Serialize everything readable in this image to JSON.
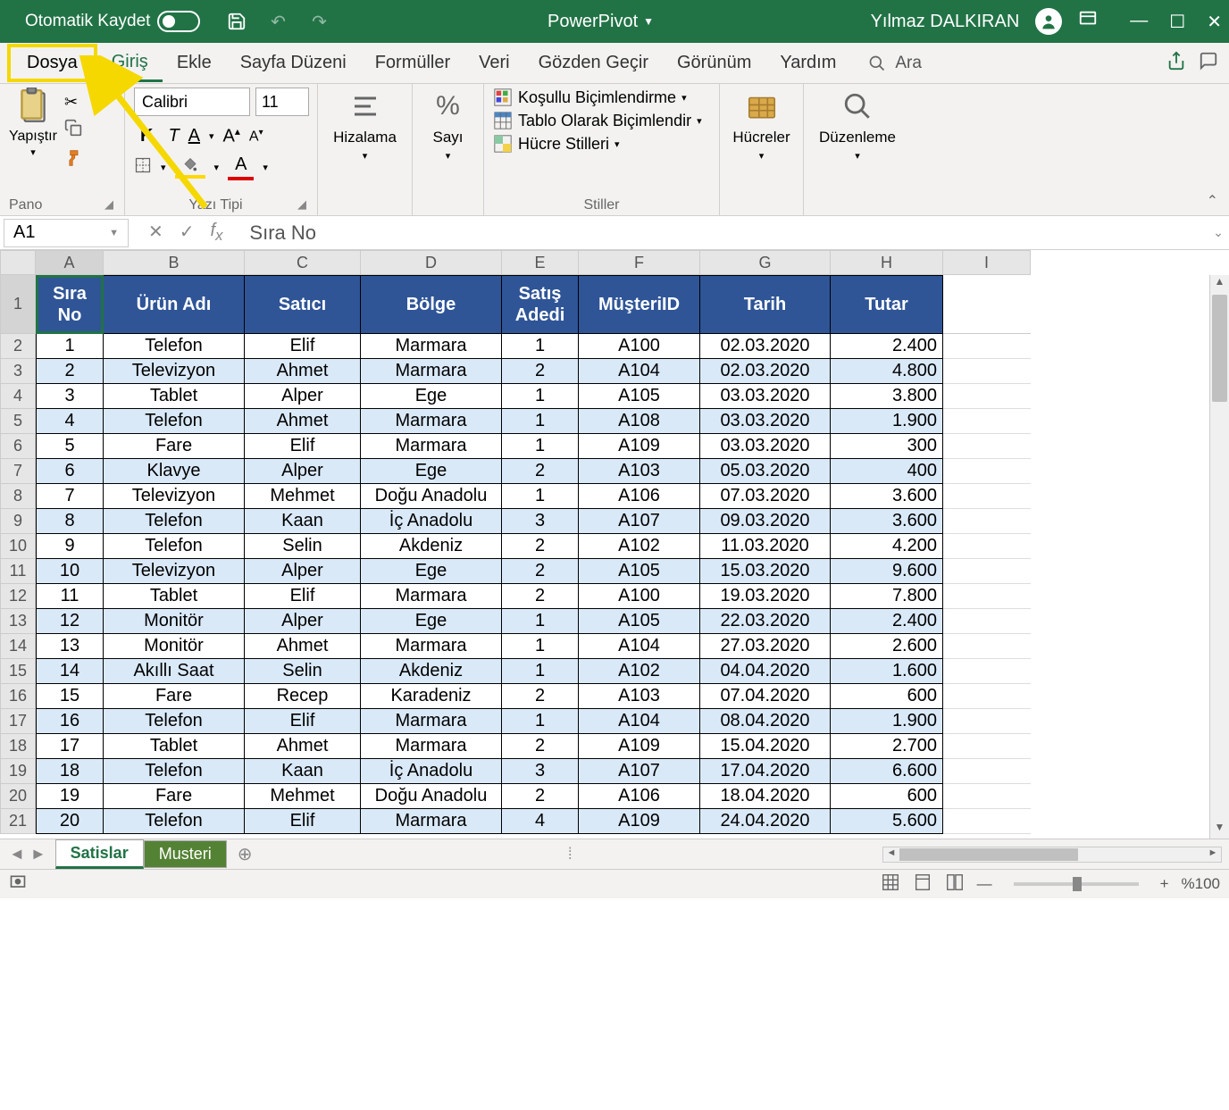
{
  "titlebar": {
    "autosave": "Otomatik Kaydet",
    "workbook": "PowerPivot",
    "user": "Yılmaz DALKIRAN"
  },
  "tabs": {
    "file": "Dosya",
    "home": "Giriş",
    "insert": "Ekle",
    "layout": "Sayfa Düzeni",
    "formulas": "Formüller",
    "data": "Veri",
    "review": "Gözden Geçir",
    "view": "Görünüm",
    "help": "Yardım",
    "search": "Ara"
  },
  "ribbon": {
    "paste": "Yapıştır",
    "clipboard": "Pano",
    "font_name": "Calibri",
    "font_size": "11",
    "font_group": "Yazı Tipi",
    "alignment": "Hizalama",
    "number": "Sayı",
    "cond_format": "Koşullu Biçimlendirme",
    "format_table": "Tablo Olarak Biçimlendir",
    "cell_styles": "Hücre Stilleri",
    "styles": "Stiller",
    "cells": "Hücreler",
    "editing": "Düzenleme"
  },
  "formula": {
    "cell": "A1",
    "value": "Sıra No"
  },
  "columns": [
    "A",
    "B",
    "C",
    "D",
    "E",
    "F",
    "G",
    "H",
    "I"
  ],
  "headers": [
    "Sıra No",
    "Ürün Adı",
    "Satıcı",
    "Bölge",
    "Satış Adedi",
    "MüşteriID",
    "Tarih",
    "Tutar"
  ],
  "rows": [
    {
      "n": "1",
      "p": "Telefon",
      "s": "Elif",
      "r": "Marmara",
      "q": "1",
      "c": "A100",
      "d": "02.03.2020",
      "t": "2.400"
    },
    {
      "n": "2",
      "p": "Televizyon",
      "s": "Ahmet",
      "r": "Marmara",
      "q": "2",
      "c": "A104",
      "d": "02.03.2020",
      "t": "4.800"
    },
    {
      "n": "3",
      "p": "Tablet",
      "s": "Alper",
      "r": "Ege",
      "q": "1",
      "c": "A105",
      "d": "03.03.2020",
      "t": "3.800"
    },
    {
      "n": "4",
      "p": "Telefon",
      "s": "Ahmet",
      "r": "Marmara",
      "q": "1",
      "c": "A108",
      "d": "03.03.2020",
      "t": "1.900"
    },
    {
      "n": "5",
      "p": "Fare",
      "s": "Elif",
      "r": "Marmara",
      "q": "1",
      "c": "A109",
      "d": "03.03.2020",
      "t": "300"
    },
    {
      "n": "6",
      "p": "Klavye",
      "s": "Alper",
      "r": "Ege",
      "q": "2",
      "c": "A103",
      "d": "05.03.2020",
      "t": "400"
    },
    {
      "n": "7",
      "p": "Televizyon",
      "s": "Mehmet",
      "r": "Doğu Anadolu",
      "q": "1",
      "c": "A106",
      "d": "07.03.2020",
      "t": "3.600"
    },
    {
      "n": "8",
      "p": "Telefon",
      "s": "Kaan",
      "r": "İç Anadolu",
      "q": "3",
      "c": "A107",
      "d": "09.03.2020",
      "t": "3.600"
    },
    {
      "n": "9",
      "p": "Telefon",
      "s": "Selin",
      "r": "Akdeniz",
      "q": "2",
      "c": "A102",
      "d": "11.03.2020",
      "t": "4.200"
    },
    {
      "n": "10",
      "p": "Televizyon",
      "s": "Alper",
      "r": "Ege",
      "q": "2",
      "c": "A105",
      "d": "15.03.2020",
      "t": "9.600"
    },
    {
      "n": "11",
      "p": "Tablet",
      "s": "Elif",
      "r": "Marmara",
      "q": "2",
      "c": "A100",
      "d": "19.03.2020",
      "t": "7.800"
    },
    {
      "n": "12",
      "p": "Monitör",
      "s": "Alper",
      "r": "Ege",
      "q": "1",
      "c": "A105",
      "d": "22.03.2020",
      "t": "2.400"
    },
    {
      "n": "13",
      "p": "Monitör",
      "s": "Ahmet",
      "r": "Marmara",
      "q": "1",
      "c": "A104",
      "d": "27.03.2020",
      "t": "2.600"
    },
    {
      "n": "14",
      "p": "Akıllı Saat",
      "s": "Selin",
      "r": "Akdeniz",
      "q": "1",
      "c": "A102",
      "d": "04.04.2020",
      "t": "1.600"
    },
    {
      "n": "15",
      "p": "Fare",
      "s": "Recep",
      "r": "Karadeniz",
      "q": "2",
      "c": "A103",
      "d": "07.04.2020",
      "t": "600"
    },
    {
      "n": "16",
      "p": "Telefon",
      "s": "Elif",
      "r": "Marmara",
      "q": "1",
      "c": "A104",
      "d": "08.04.2020",
      "t": "1.900"
    },
    {
      "n": "17",
      "p": "Tablet",
      "s": "Ahmet",
      "r": "Marmara",
      "q": "2",
      "c": "A109",
      "d": "15.04.2020",
      "t": "2.700"
    },
    {
      "n": "18",
      "p": "Telefon",
      "s": "Kaan",
      "r": "İç Anadolu",
      "q": "3",
      "c": "A107",
      "d": "17.04.2020",
      "t": "6.600"
    },
    {
      "n": "19",
      "p": "Fare",
      "s": "Mehmet",
      "r": "Doğu Anadolu",
      "q": "2",
      "c": "A106",
      "d": "18.04.2020",
      "t": "600"
    },
    {
      "n": "20",
      "p": "Telefon",
      "s": "Elif",
      "r": "Marmara",
      "q": "4",
      "c": "A109",
      "d": "24.04.2020",
      "t": "5.600"
    }
  ],
  "sheets": {
    "s1": "Satislar",
    "s2": "Musteri"
  },
  "status": {
    "zoom": "%100"
  }
}
